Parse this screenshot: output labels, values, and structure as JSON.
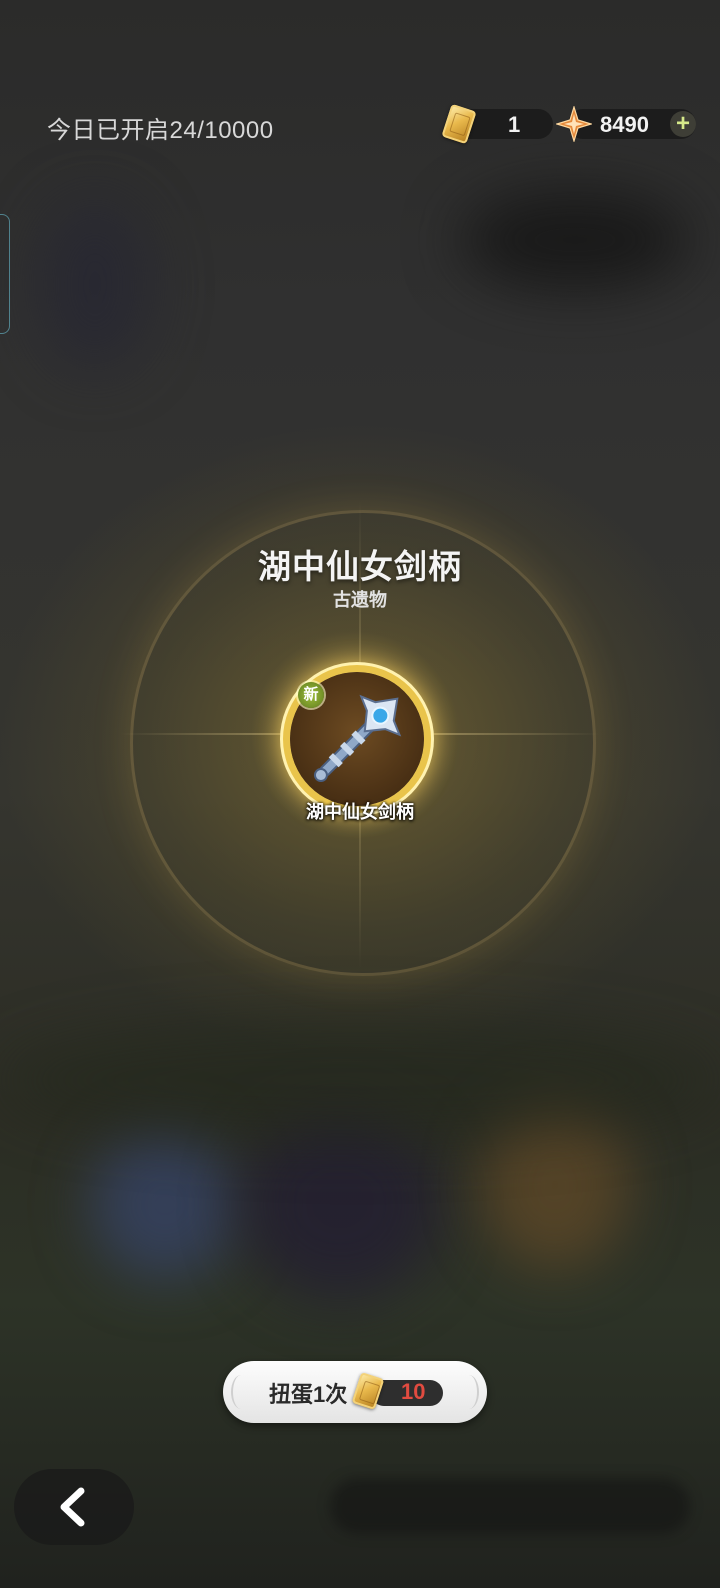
{
  "header": {
    "daily_opened_text": "今日已开启24/10000",
    "ticket_count": "1",
    "star_currency_count": "8490",
    "add_icon": "plus-icon"
  },
  "reward": {
    "item_name": "湖中仙女剑柄",
    "item_category": "古遗物",
    "new_badge": "新",
    "item_caption": "湖中仙女剑柄",
    "item_icon": "sword-hilt-icon"
  },
  "actions": {
    "spin_label": "扭蛋1次",
    "spin_cost": "10",
    "back_icon": "chevron-left-icon"
  },
  "colors": {
    "cost_red": "#e14b40",
    "plus_green": "#d6e98a",
    "medal_gold": "#e9c44b",
    "new_badge_green": "#7a9a2a"
  }
}
